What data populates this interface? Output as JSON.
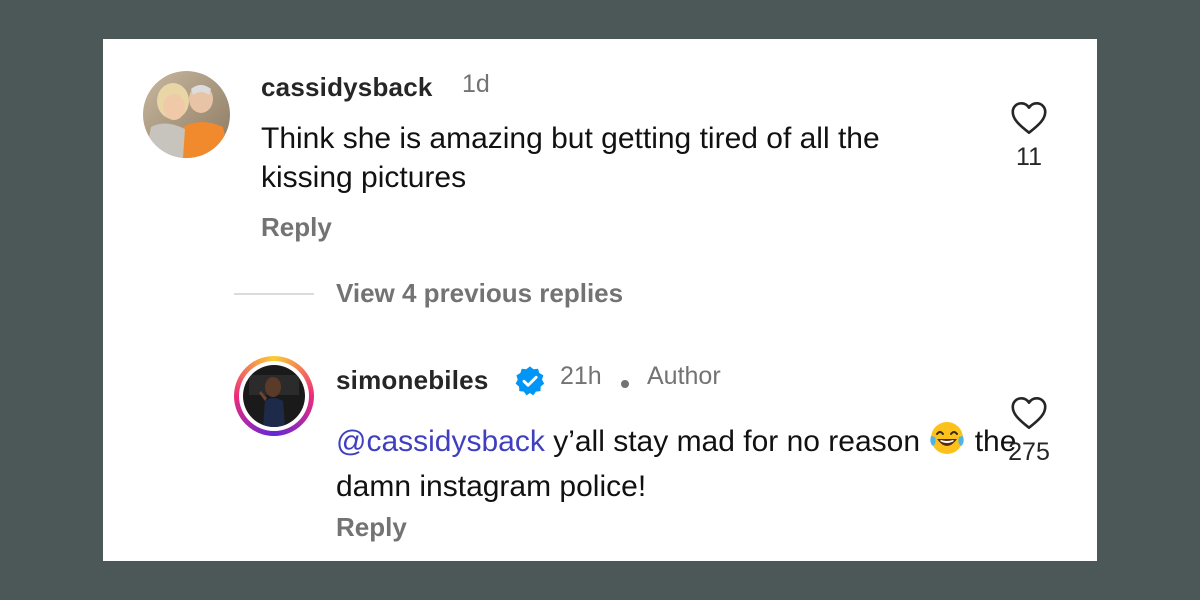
{
  "comments": [
    {
      "username": "cassidysback",
      "time": "1d",
      "text": "Think she is amazing but getting tired of all the kissing pictures",
      "reply_label": "Reply",
      "likes": "11",
      "avatar_icon": "user-photo"
    },
    {
      "username": "simonebiles",
      "verified": true,
      "time": "21h",
      "separator": "•",
      "author_label": "Author",
      "mention": "@cassidysback",
      "text_part1": " y’all stay mad for no reason ",
      "emoji": "face-with-tears-of-joy",
      "text_part2": " the damn instagram police!",
      "reply_label": "Reply",
      "likes": "275",
      "avatar_icon": "user-photo-story-ring"
    }
  ],
  "thread": {
    "view_replies_label": "View 4 previous replies"
  },
  "colors": {
    "background": "#4b5857",
    "card": "#ffffff",
    "mention": "#3f3fc0",
    "verified": "#0095f6",
    "muted": "#737373"
  }
}
